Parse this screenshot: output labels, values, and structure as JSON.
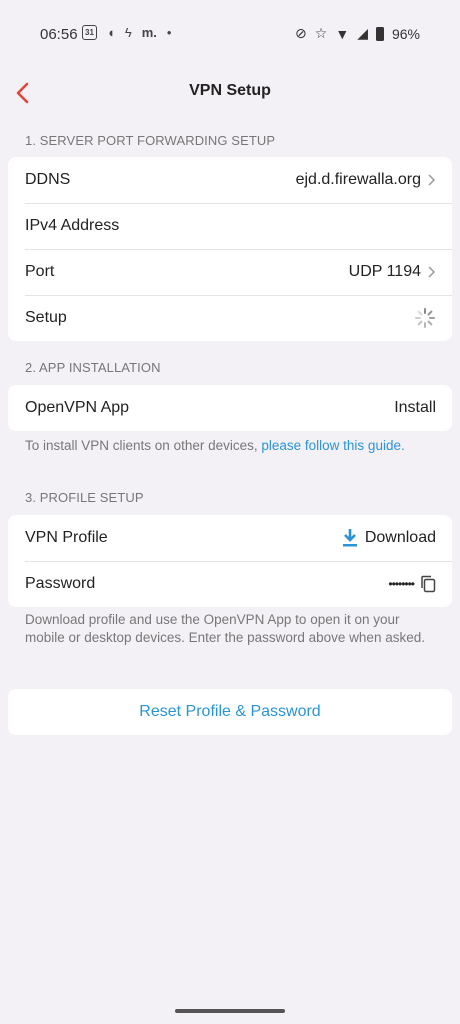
{
  "status_bar": {
    "time": "06:56",
    "calendar_day": "31",
    "carrier_glyph": "m.",
    "battery": "96%"
  },
  "header": {
    "title": "VPN Setup"
  },
  "sections": {
    "server": {
      "label": "1. SERVER PORT FORWARDING SETUP",
      "rows": [
        {
          "label": "DDNS",
          "value": "ejd.d.firewalla.org"
        },
        {
          "label": "IPv4 Address",
          "value": ""
        },
        {
          "label": "Port",
          "value": "UDP 1194"
        },
        {
          "label": "Setup",
          "value": ""
        }
      ]
    },
    "app": {
      "label": "2. APP INSTALLATION",
      "row_label": "OpenVPN App",
      "action": "Install",
      "note_text": "To install VPN clients on other devices, ",
      "note_link": "please follow this guide."
    },
    "profile": {
      "label": "3. PROFILE SETUP",
      "profile_label": "VPN Profile",
      "download": "Download",
      "password_label": "Password",
      "password_value": "••••••••",
      "note": "Download profile and use the OpenVPN App to open it on your mobile or desktop devices. Enter the password above when asked."
    }
  },
  "reset_button": "Reset Profile & Password",
  "colors": {
    "accent": "#2b94d6",
    "back": "#e0463c",
    "background": "#f4f1f6"
  }
}
